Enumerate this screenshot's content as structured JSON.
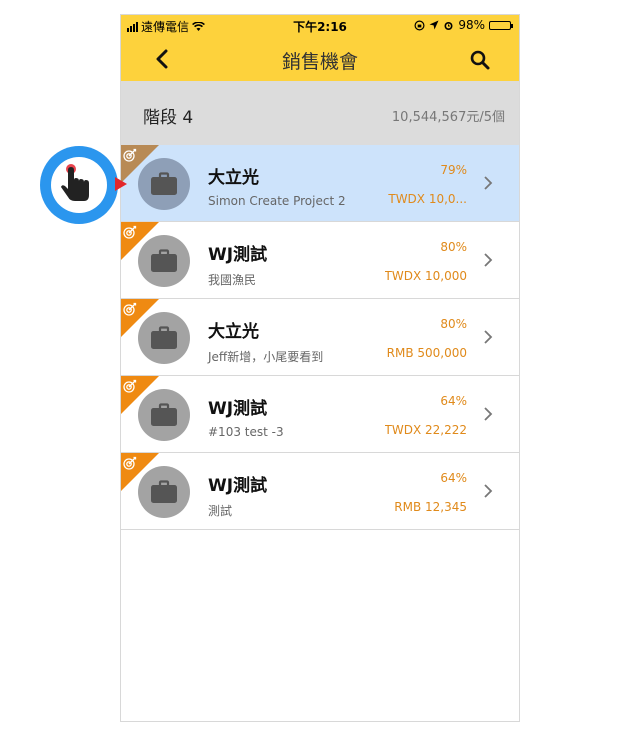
{
  "status_bar": {
    "carrier": "遠傳電信",
    "time": "下午2:16",
    "battery": "98%"
  },
  "nav": {
    "title": "銷售機會"
  },
  "stage": {
    "title": "階段 4",
    "summary": "10,544,567元/5個"
  },
  "opportunities": [
    {
      "name": "大立光",
      "subtitle": "Simon Create Project 2",
      "percent": "79%",
      "amount": "TWDX 10,0...",
      "selected": true
    },
    {
      "name": "WJ測試",
      "subtitle": "我國漁民",
      "percent": "80%",
      "amount": "TWDX 10,000",
      "selected": false
    },
    {
      "name": "大立光",
      "subtitle": "Jeff新增，小尾要看到",
      "percent": "80%",
      "amount": "RMB 500,000",
      "selected": false
    },
    {
      "name": "WJ測試",
      "subtitle": "#103 test -3",
      "percent": "64%",
      "amount": "TWDX 22,222",
      "selected": false
    },
    {
      "name": "WJ測試",
      "subtitle": "測試",
      "percent": "64%",
      "amount": "RMB 12,345",
      "selected": false
    }
  ],
  "colors": {
    "accent": "#fdd23c",
    "corner_badge": "#ef8a12",
    "amount_text": "#e08a1b",
    "selected_row": "#cde3fb",
    "tap_indicator": "#2b96ee"
  }
}
